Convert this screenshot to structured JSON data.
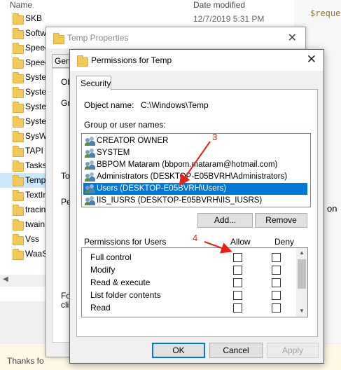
{
  "explorer": {
    "col_name": "Name",
    "col_date": "Date modified",
    "date_value": "12/7/2019 5:31 PM",
    "folders": [
      "SKB",
      "Softw",
      "Speec",
      "Speec",
      "Syster",
      "Syster",
      "Syster",
      "Syster",
      "SysWO",
      "TAPI",
      "Tasks",
      "Temp",
      "TextIn",
      "tracin",
      "twain",
      "Vss",
      "WaaS"
    ],
    "selected_index": 11
  },
  "background": {
    "code_snippet": "$reque",
    "side_text": "on",
    "bottom_text": "Thanks fo"
  },
  "temp_properties": {
    "title": "Temp Properties",
    "partial": {
      "gen": "Gen",
      "ob": "Ob",
      "gro": "Gro",
      "to": "To",
      "per": "Per",
      "for": "For",
      "cli": "clic"
    }
  },
  "permissions": {
    "title": "Permissions for Temp",
    "tab": "Security",
    "object_label": "Object name:",
    "object_value": "C:\\Windows\\Temp",
    "group_label": "Group or user names:",
    "users": [
      "CREATOR OWNER",
      "SYSTEM",
      "BBPOM Mataram (bbpom.mataram@hotmail.com)",
      "Administrators (DESKTOP-E05BVRH\\Administrators)",
      "Users (DESKTOP-E05BVRH\\Users)",
      "IIS_IUSRS (DESKTOP-E05BVRH\\IIS_IUSRS)"
    ],
    "selected_user_index": 4,
    "add_label": "Add...",
    "remove_label": "Remove",
    "perm_label": "Permissions for Users",
    "allow_label": "Allow",
    "deny_label": "Deny",
    "perms": [
      "Full control",
      "Modify",
      "Read & execute",
      "List folder contents",
      "Read"
    ],
    "ok_label": "OK",
    "cancel_label": "Cancel",
    "apply_label": "Apply"
  },
  "annotations": {
    "step3": "3",
    "step4": "4",
    "color": "#e8211a"
  }
}
